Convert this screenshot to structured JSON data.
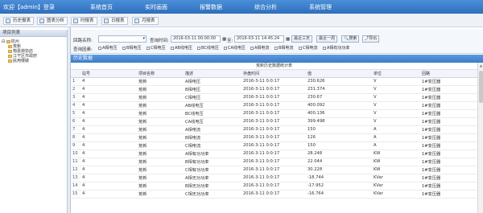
{
  "header": {
    "welcome": "欢迎【admin】登录",
    "menu": [
      "系统首页",
      "实时画面",
      "报警数据",
      "综合分析",
      "系统管理"
    ]
  },
  "toolbar": {
    "buttons": [
      "历史报表",
      "图表分析",
      "时报表",
      "日报表",
      "月报表"
    ]
  },
  "sidebar": {
    "title": "项目列表",
    "tree": [
      {
        "label": "杭州",
        "level": 0
      },
      {
        "label": "荒新",
        "level": 1
      },
      {
        "label": "物嘉荷协店",
        "level": 1
      },
      {
        "label": "江干区市政府",
        "level": 1
      },
      {
        "label": "民用楼破",
        "level": 1
      }
    ]
  },
  "filter": {
    "loop_label": "回路名称:",
    "loop_value": "",
    "time_label": "查询时间:",
    "start_time": "2016-03-11 00:00:00",
    "to_label": "至:",
    "end_time": "2016-03-11 14:45:24",
    "btn_3days": "最近三天",
    "btn_week": "最近一周",
    "btn_search": "搜索",
    "btn_export": "导出",
    "factors_label": "查询因素:",
    "factors": [
      "A相电压",
      "B相电压",
      "C相电压",
      "AB线电压",
      "BC线电压",
      "CA线电压",
      "A相电流",
      "B相电流",
      "C相电流",
      "A相有功功率"
    ]
  },
  "history": {
    "title": "历史数据",
    "caption": "荒新历史数据统计表",
    "columns": [
      "站号",
      "项目名称",
      "描述",
      "存盘时间",
      "值",
      "单位",
      "回路"
    ],
    "rows": [
      [
        "1",
        "4",
        "荒新",
        "A相电压",
        "2016-3-11 0:0:17",
        "230.626",
        "V",
        "1#变压器"
      ],
      [
        "2",
        "4",
        "荒新",
        "B相电压",
        "2016-3-11 0:0:17",
        "231.374",
        "V",
        "1#变压器"
      ],
      [
        "3",
        "4",
        "荒新",
        "C相电压",
        "2016-3-11 0:0:17",
        "230.67",
        "V",
        "1#变压器"
      ],
      [
        "4",
        "4",
        "荒新",
        "AB线电压",
        "2016-3-11 0:0:17",
        "400.092",
        "V",
        "1#变压器"
      ],
      [
        "5",
        "4",
        "荒新",
        "BC线电压",
        "2016-3-11 0:0:17",
        "400.136",
        "V",
        "1#变压器"
      ],
      [
        "6",
        "4",
        "荒新",
        "CA线电压",
        "2016-3-11 0:0:17",
        "399.498",
        "V",
        "1#变压器"
      ],
      [
        "7",
        "4",
        "荒新",
        "A相电流",
        "2016-3-11 0:0:17",
        "150",
        "A",
        "1#变压器"
      ],
      [
        "8",
        "4",
        "荒新",
        "B相电流",
        "2016-3-11 0:0:17",
        "126",
        "A",
        "1#变压器"
      ],
      [
        "9",
        "4",
        "荒新",
        "C相电流",
        "2016-3-11 0:0:17",
        "150",
        "A",
        "1#变压器"
      ],
      [
        "10",
        "4",
        "荒新",
        "A相有功功率",
        "2016-3-11 0:0:17",
        "28.248",
        "KW",
        "1#变压器"
      ],
      [
        "11",
        "4",
        "荒新",
        "B相有功功率",
        "2016-3-11 0:0:17",
        "22.044",
        "KW",
        "1#变压器"
      ],
      [
        "12",
        "4",
        "荒新",
        "C相有功功率",
        "2016-3-11 0:0:17",
        "30.228",
        "KW",
        "1#变压器"
      ],
      [
        "13",
        "4",
        "荒新",
        "A相无功功率",
        "2016-3-11 0:0:17",
        "-18.744",
        "KVar",
        "1#变压器"
      ],
      [
        "14",
        "4",
        "荒新",
        "B相无功功率",
        "2016-3-11 0:0:17",
        "-17.952",
        "KVar",
        "1#变压器"
      ],
      [
        "15",
        "4",
        "荒新",
        "C相无功功率",
        "2016-3-11 0:0:17",
        "-16.764",
        "KVar",
        "1#变压器"
      ]
    ]
  },
  "colors": {
    "header": "#2f6fbd",
    "panel_head": "#3d7cc6"
  }
}
